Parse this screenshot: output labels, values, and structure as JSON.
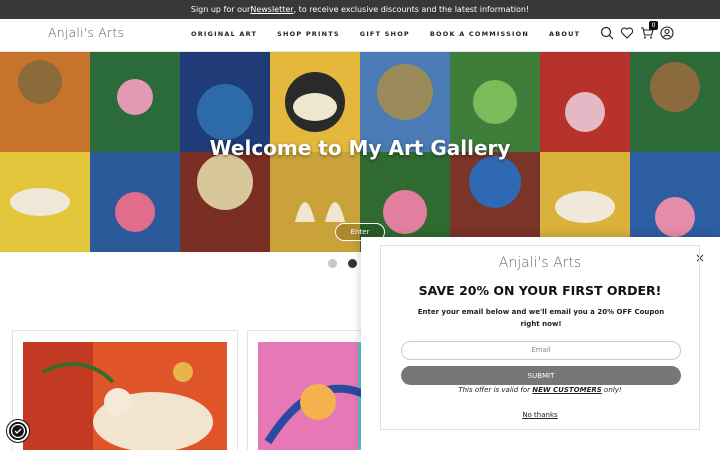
{
  "announcement": {
    "prefix": "Sign up for our ",
    "link": "Newsletter",
    "suffix": ", to receive exclusive discounts and the latest information!"
  },
  "header": {
    "logo": "Anjali's Arts",
    "nav": [
      "ORIGINAL ART",
      "SHOP PRINTS",
      "GIFT SHOP",
      "BOOK A COMMISSION",
      "ABOUT"
    ],
    "cart_count": "0",
    "icons": [
      "search-icon",
      "heart-icon",
      "cart-icon",
      "account-icon"
    ]
  },
  "hero": {
    "title": "Welcome to My Art Gallery",
    "button": "Enter"
  },
  "popup": {
    "logo": "Anjali's Arts",
    "close": "×",
    "title": "SAVE 20% ON YOUR FIRST ORDER!",
    "subtitle": "Enter your email below and we'll email you a 20% OFF Coupon right now!",
    "email_placeholder": "Email",
    "submit": "SUBMIT",
    "terms_prefix": "This offer is valid for ",
    "terms_highlight": "NEW CUSTOMERS",
    "terms_suffix": " only!",
    "decline": "No thanks"
  },
  "colors": {
    "topbar": "#383838",
    "submit": "#777777"
  }
}
